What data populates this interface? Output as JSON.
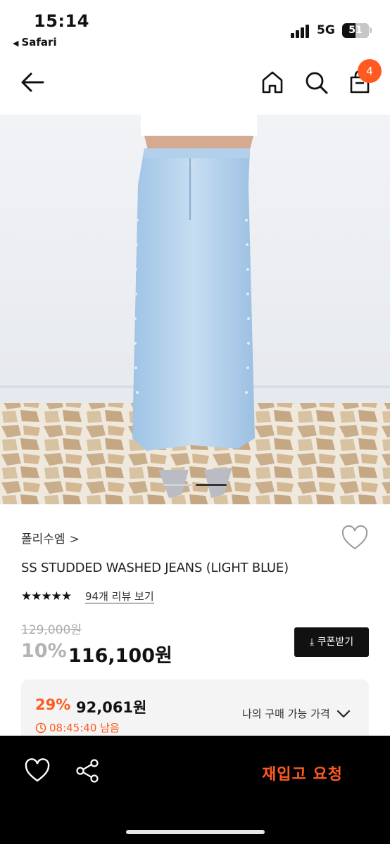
{
  "status_bar": {
    "time": "15:14",
    "back_app": "Safari",
    "network": "5G",
    "battery": "51",
    "battery_level": 0.51
  },
  "header": {
    "cart_count": "4",
    "icons": [
      "arrow-left-icon",
      "home-icon",
      "search-icon",
      "shopping-bag-icon"
    ]
  },
  "gallery": {
    "image_count": 2,
    "active_index": 1
  },
  "product": {
    "brand": "폴리수엠",
    "brand_chevron": ">",
    "name": "SS STUDDED WASHED JEANS (LIGHT BLUE)",
    "stars": "★★★★★",
    "rating": 5,
    "reviews_label": "94개 리뷰 보기",
    "original_price": "129,000원",
    "discount": "10%",
    "sale_price": "116,100원",
    "coupon_label": "쿠폰받기"
  },
  "best_price": {
    "percent": "29%",
    "price": "92,061원",
    "timer": "08:45:40 남음",
    "label": "나의 구매 가능 가격"
  },
  "bottom_bar": {
    "restock_label": "재입고 요청"
  },
  "colors": {
    "accent": "#ff5a1f",
    "bottom_bar": "#000000",
    "best_box": "#f4f4f4"
  }
}
